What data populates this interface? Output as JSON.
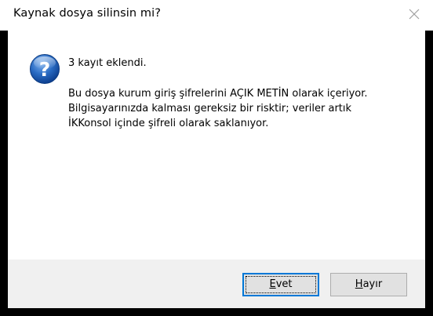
{
  "window": {
    "title": "Kaynak dosya silinsin mi?",
    "close_icon": "close-icon"
  },
  "message": {
    "icon": "question-icon",
    "line1": "3 kayıt eklendi.",
    "paragraph": [
      "Bu dosya kurum giriş şifrelerini AÇIK METİN olarak içeriyor.",
      "Bilgisayarınızda kalması gereksiz bir risktir; veriler artık",
      "İKKonsol içinde şifreli olarak saklanıyor."
    ]
  },
  "buttons": {
    "yes": {
      "mnemonic": "E",
      "rest": "vet"
    },
    "no": {
      "mnemonic": "H",
      "rest": "ayır"
    }
  },
  "colors": {
    "accent": "#0078d7",
    "footer": "#f0f0f0",
    "icon_blue": "#1c5fb7"
  }
}
